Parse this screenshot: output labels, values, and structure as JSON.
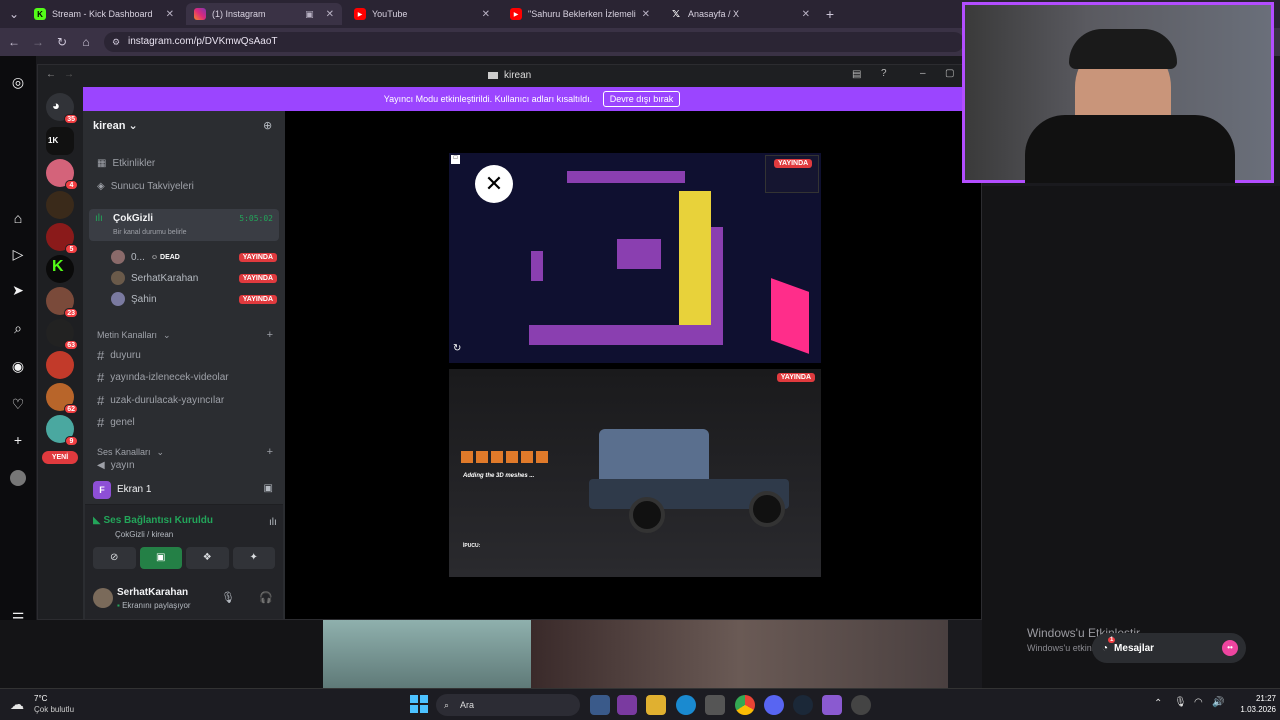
{
  "browser": {
    "tabs": [
      {
        "title": "Stream - Kick Dashboard",
        "active": false
      },
      {
        "title": "(1) Instagram",
        "active": true
      },
      {
        "title": "YouTube",
        "active": false
      },
      {
        "title": "\"Sahuru Beklerken İzlemelik Ed...",
        "active": false
      },
      {
        "title": "Anasayfa / X",
        "active": false
      }
    ],
    "url": "instagram.com/p/DVKmwQsAaoT"
  },
  "discord": {
    "window_title": "kirean",
    "banner": {
      "text": "Yayıncı Modu etkinleştirildi. Kullanıcı adları kısaltıldı.",
      "button": "Devre dışı bırak"
    },
    "server_name": "kirean",
    "menu": [
      "Etkinlikler",
      "Sunucu Takviyeleri"
    ],
    "voice_channel": {
      "name": "ÇokGizli",
      "timer": "5:05:02",
      "status_hint": "Bir kanal durumu belirle",
      "members": [
        {
          "name": "0...",
          "extra": "DEAD",
          "live": "YAYINDA"
        },
        {
          "name": "SerhatKarahan",
          "extra": "",
          "live": "YAYINDA"
        },
        {
          "name": "Şahin",
          "extra": "",
          "live": "YAYINDA"
        }
      ]
    },
    "text_category": "Metin Kanalları",
    "text_channels": [
      "duyuru",
      "yayında-izlenecek-videolar",
      "uzak-durulacak-yayıncılar",
      "genel"
    ],
    "voice_category": "Ses Kanalları",
    "voice_partial": "yayın",
    "new_badge": "YENİ",
    "screen_share": "Ekran 1",
    "connection": {
      "status": "Ses Bağlantısı Kuruldu",
      "where": "ÇokGizli / kirean"
    },
    "user": {
      "name": "SerhatKarahan",
      "status": "Ekranını paylaşıyor"
    },
    "streams": [
      {
        "live": "YAYINDA"
      },
      {
        "live": "YAYINDA",
        "game_heading": "Adding the 3D meshes ...",
        "tip": "İPUCU:"
      }
    ],
    "server_badges": [
      "35",
      "4",
      "5",
      "23",
      "63",
      "62",
      "9"
    ]
  },
  "desktop": {
    "activation_title": "Windows'u Etkinleştir",
    "activation_sub": "Windows'u etkinleştirmek için Ayarlar'a gidin.",
    "messages": "Mesajlar",
    "messages_badge": "1"
  },
  "taskbar": {
    "weather_temp": "7°C",
    "weather_desc": "Çok bulutlu",
    "search": "Ara",
    "time": "21:27",
    "date": "1.03.2026"
  }
}
